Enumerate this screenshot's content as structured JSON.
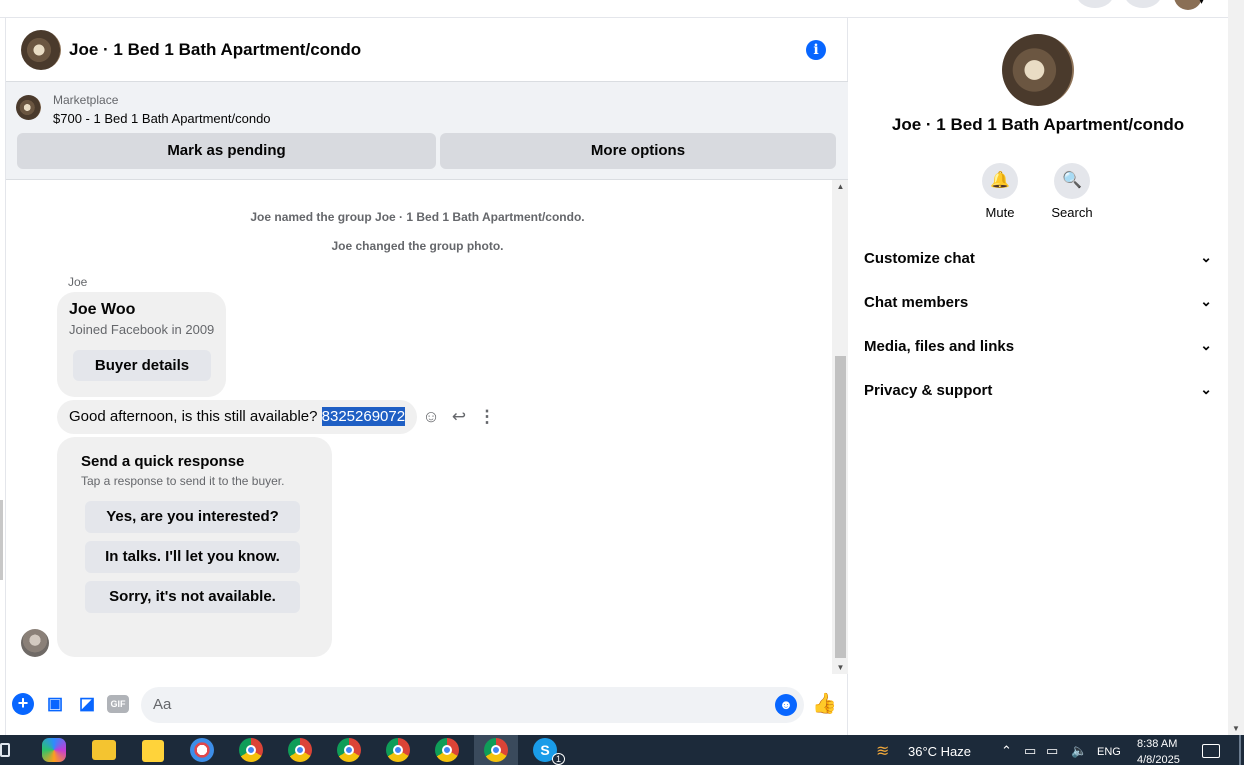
{
  "header": {
    "title": "Joe · 1 Bed 1 Bath Apartment/condo"
  },
  "marketplace": {
    "label": "Marketplace",
    "listing": "$700 - 1 Bed 1 Bath Apartment/condo",
    "mark_pending": "Mark as pending",
    "more_options": "More options"
  },
  "messages": {
    "system": [
      "Joe named the group Joe · 1 Bed 1 Bath Apartment/condo.",
      "Joe changed the group photo."
    ],
    "sender": "Joe",
    "profile": {
      "name": "Joe Woo",
      "joined": "Joined Facebook in 2009",
      "buyer_details": "Buyer details"
    },
    "message_text": "Good afternoon, is this still available? ",
    "message_phone": "8325269072",
    "quick_response": {
      "title": "Send a quick response",
      "subtitle": "Tap a response to send it to the buyer.",
      "options": [
        "Yes, are you interested?",
        "In talks. I'll let you know.",
        "Sorry, it's not available."
      ]
    }
  },
  "composer": {
    "placeholder": "Aa"
  },
  "right_panel": {
    "title": "Joe · 1 Bed 1 Bath Apartment/condo",
    "actions": [
      "Mute",
      "Search"
    ],
    "sections": [
      "Customize chat",
      "Chat members",
      "Media, files and links",
      "Privacy & support"
    ]
  },
  "taskbar": {
    "skype_badge": "1",
    "weather": "36°C  Haze",
    "language": "ENG",
    "time": "8:38 AM",
    "date": "4/8/2025"
  },
  "colors": {
    "accent": "#0866ff",
    "selection": "#1f5fc4",
    "taskbar": "#1c2a3a"
  }
}
